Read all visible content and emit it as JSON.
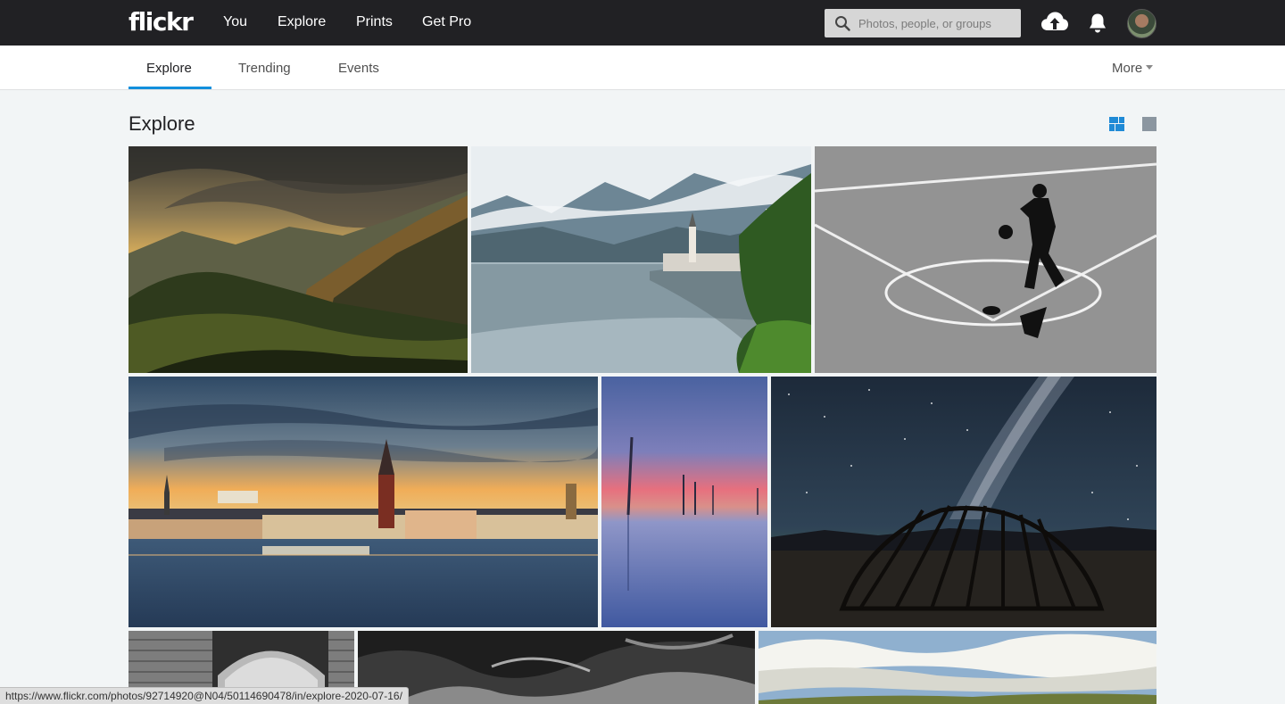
{
  "header": {
    "logo": "flickr",
    "nav": [
      "You",
      "Explore",
      "Prints",
      "Get Pro"
    ],
    "search_placeholder": "Photos, people, or groups",
    "icons": [
      "upload-icon",
      "bell-icon",
      "avatar"
    ]
  },
  "subnav": {
    "tabs": [
      "Explore",
      "Trending",
      "Events"
    ],
    "active_tab": "Explore",
    "more_label": "More"
  },
  "page": {
    "title": "Explore",
    "view_modes": [
      "justified-grid-icon",
      "single-view-icon"
    ],
    "active_view": "justified-grid-icon"
  },
  "photos": [
    {
      "subject": "mountain-valley-sunset"
    },
    {
      "subject": "hallstatt-lake-village"
    },
    {
      "subject": "bw-basketball-player"
    },
    {
      "subject": "stockholm-city-sunset"
    },
    {
      "subject": "poles-in-water-dusk"
    },
    {
      "subject": "milky-way-driftwood-hut"
    },
    {
      "subject": "bw-brick-arch"
    },
    {
      "subject": "bw-rocks-water"
    },
    {
      "subject": "cloudy-sky-landscape"
    }
  ],
  "status_url": "https://www.flickr.com/photos/92714920@N04/50114690478/in/explore-2020-07-16/",
  "colors": {
    "topbar": "#212124",
    "accent": "#128fdc",
    "background": "#f2f5f6"
  }
}
